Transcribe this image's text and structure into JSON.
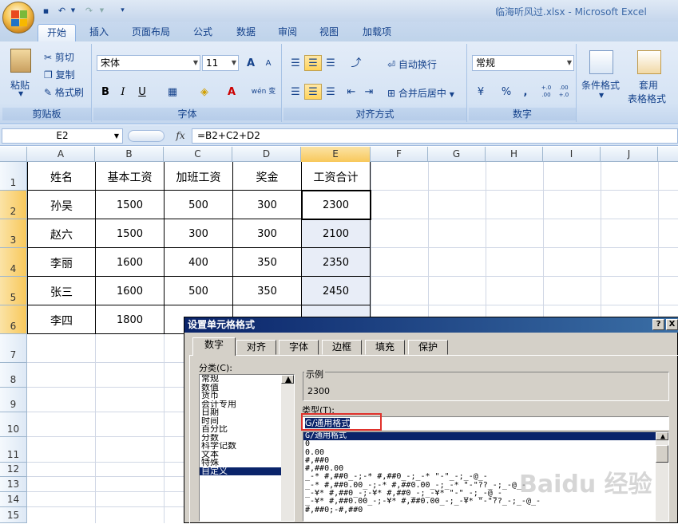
{
  "window": {
    "title": "临海听风过.xlsx - Microsoft Excel"
  },
  "tabs": [
    "开始",
    "插入",
    "页面布局",
    "公式",
    "数据",
    "审阅",
    "视图",
    "加载项"
  ],
  "ribbon": {
    "clipboard": {
      "label": "剪贴板",
      "paste": "粘贴",
      "cut": "剪切",
      "copy": "复制",
      "format_painter": "格式刷"
    },
    "font": {
      "label": "字体",
      "name": "宋体",
      "size": "11",
      "bold": "B",
      "italic": "I",
      "underline": "U",
      "grow": "A",
      "shrink": "A",
      "color_a": "A",
      "phonetic": "wén 变"
    },
    "alignment": {
      "label": "对齐方式",
      "wrap": "自动换行",
      "merge": "合并后居中"
    },
    "number": {
      "label": "数字",
      "format": "常规",
      "percent": "%",
      "comma": ",",
      "inc": "+.0 .00",
      "dec": ".00 +.0"
    },
    "styles": {
      "conditional": "条件格式",
      "table1": "套用",
      "table2": "表格格式"
    }
  },
  "formula_bar": {
    "name_box": "E2",
    "fx": "fx",
    "formula": "=B2+C2+D2"
  },
  "columns": [
    "A",
    "B",
    "C",
    "D",
    "E",
    "F",
    "G",
    "H",
    "I",
    "J"
  ],
  "rows": [
    "1",
    "2",
    "3",
    "4",
    "5",
    "6",
    "7",
    "8",
    "9",
    "10",
    "11",
    "12",
    "13",
    "14",
    "15"
  ],
  "sheet": {
    "header": [
      "姓名",
      "基本工资",
      "加班工资",
      "奖金",
      "工资合计"
    ],
    "data": [
      [
        "孙吴",
        "1500",
        "500",
        "300",
        "2300"
      ],
      [
        "赵六",
        "1500",
        "300",
        "300",
        "2100"
      ],
      [
        "李丽",
        "1600",
        "400",
        "350",
        "2350"
      ],
      [
        "张三",
        "1600",
        "500",
        "350",
        "2450"
      ],
      [
        "李四",
        "1800",
        "",
        "",
        ""
      ]
    ]
  },
  "dialog": {
    "title": "设置单元格格式",
    "help": "?",
    "close": "X",
    "tabs": [
      "数字",
      "对齐",
      "字体",
      "边框",
      "填充",
      "保护"
    ],
    "category_label": "分类(C):",
    "categories": [
      "常规",
      "数值",
      "货币",
      "会计专用",
      "日期",
      "时间",
      "百分比",
      "分数",
      "科学记数",
      "文本",
      "特殊",
      "自定义"
    ],
    "sample_label": "示例",
    "sample_value": "2300",
    "type_label": "类型(T):",
    "type_value": "G/通用格式",
    "types": [
      "G/通用格式",
      "0",
      "0.00",
      "#,##0",
      "#,##0.00",
      "_-* #,##0_-;-* #,##0_-;_-* \"-\"_-;_-@_-",
      "_-* #,##0.00_-;-* #,##0.00_-;_-* \"-\"??_-;_-@_-",
      "_-¥* #,##0_-;-¥* #,##0_-;_-¥* \"-\"_-;_-@_-",
      "_-¥* #,##0.00_-;-¥* #,##0.00_-;_-¥* \"-\"??_-;_-@_-",
      "#,##0;-#,##0"
    ]
  },
  "watermark": "Baidu 经验"
}
